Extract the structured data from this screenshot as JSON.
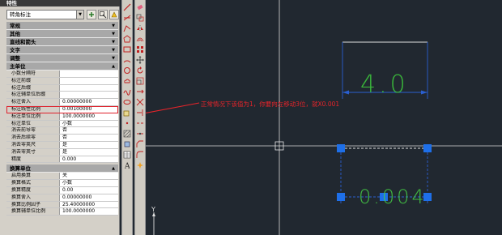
{
  "palette": {
    "title": "特性",
    "object_type": "转角标注",
    "categories": {
      "general": "常规",
      "misc": "其他",
      "lines_arrows": "直线和箭头",
      "text": "文字",
      "fit": "调整",
      "primary_units": "主单位",
      "alt_units": "换算单位"
    },
    "primary_rows": [
      {
        "key": "小数分隔符",
        "value": ""
      },
      {
        "key": "标注前缀",
        "value": ""
      },
      {
        "key": "标注后缀",
        "value": ""
      },
      {
        "key": "标注辅单位后缀",
        "value": ""
      },
      {
        "key": "标注舍入",
        "value": "0.00000000"
      },
      {
        "key": "标注线性比例",
        "value": "0.00100000"
      },
      {
        "key": "标注单位比例",
        "value": "100.0000000"
      },
      {
        "key": "标注单位",
        "value": "小数"
      },
      {
        "key": "消去前导零",
        "value": "否"
      },
      {
        "key": "消去后续零",
        "value": "否"
      },
      {
        "key": "消去零英尺",
        "value": "是"
      },
      {
        "key": "消去零英寸",
        "value": "是"
      },
      {
        "key": "精度",
        "value": "0.000"
      }
    ],
    "alt_rows": [
      {
        "key": "启用换算",
        "value": "关"
      },
      {
        "key": "换算格式",
        "value": "小数"
      },
      {
        "key": "换算精度",
        "value": "0.00"
      },
      {
        "key": "换算舍入",
        "value": "0.00000000"
      },
      {
        "key": "换算比例因子",
        "value": "25.40000000"
      },
      {
        "key": "换算辅单位比例",
        "value": "100.0000000"
      }
    ]
  },
  "annotation": "正常情况下该值为1，你要向左移动3位，就X0.001",
  "dimensions": {
    "upper": "4.0",
    "lower": "0.004"
  },
  "ucs_label": "Y",
  "colors": {
    "canvas_bg": "#212830",
    "dimension_green": "#3cc43c",
    "grip_blue": "#1e6fe8",
    "annotation_red": "#e8242a"
  }
}
